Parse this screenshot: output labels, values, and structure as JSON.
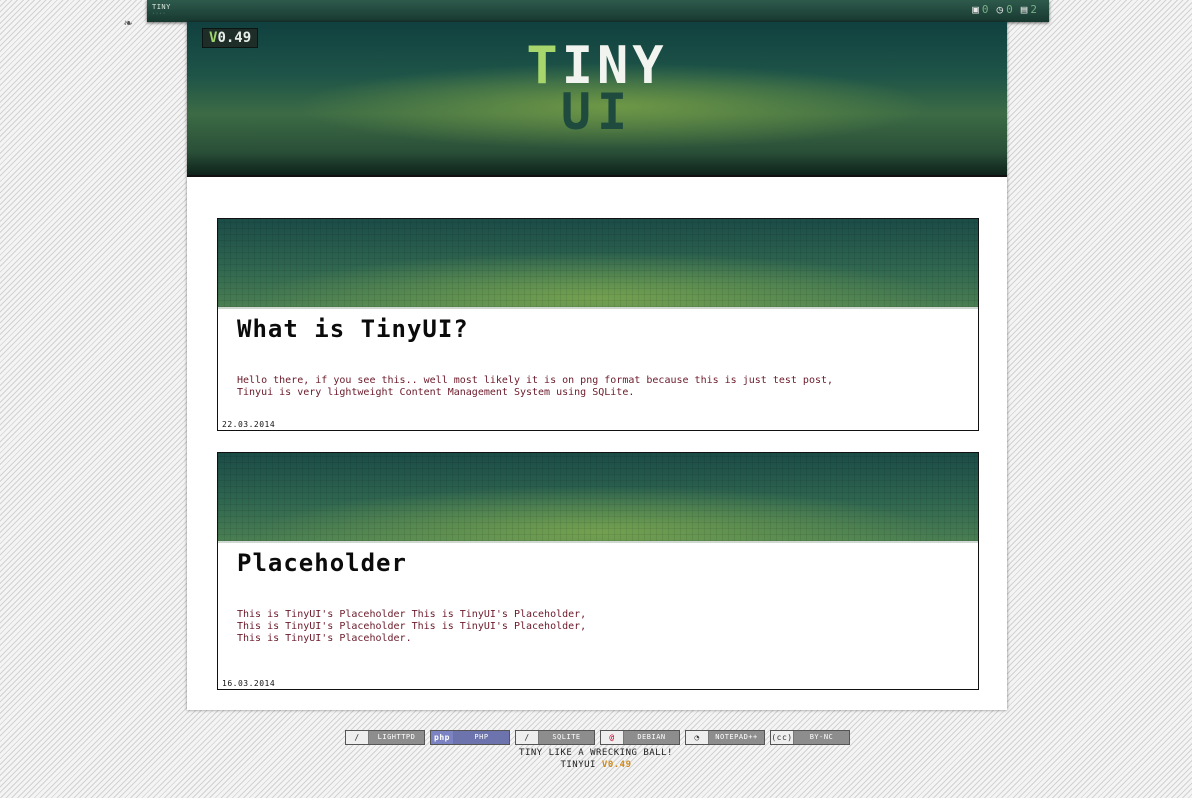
{
  "topbar": {
    "brand": "TINY",
    "stats": [
      {
        "icon": "save-icon",
        "glyph": "▣",
        "value": "0"
      },
      {
        "icon": "clock-icon",
        "glyph": "◷",
        "value": "0"
      },
      {
        "icon": "document-icon",
        "glyph": "▤",
        "value": "2"
      }
    ]
  },
  "header": {
    "version_prefix": "V",
    "version_number": "0.49",
    "logo_first": "T",
    "logo_rest": "INY",
    "logo_sub": "UI"
  },
  "posts": [
    {
      "title": "What is TinyUI?",
      "body": "Hello there, if you see this.. well most likely it is on png format because this is just test post,\nTinyui is very lightweight Content Management System using SQLite.",
      "date": "22.03.2014"
    },
    {
      "title": "Placeholder",
      "body": "This is TinyUI's Placeholder This is TinyUI's Placeholder,\nThis is TinyUI's Placeholder This is TinyUI's Placeholder,\nThis is TinyUI's Placeholder.",
      "date": "16.03.2014"
    }
  ],
  "badges": [
    {
      "icon": "feather-icon",
      "glyph": "∕",
      "label": "LIGHTTPD"
    },
    {
      "icon": "php-logo-icon",
      "glyph": "php",
      "label": "PHP"
    },
    {
      "icon": "feather-icon",
      "glyph": "∕",
      "label": "SQLITE"
    },
    {
      "icon": "debian-swirl-icon",
      "glyph": "@",
      "label": "DEBIAN"
    },
    {
      "icon": "chameleon-icon",
      "glyph": "◔",
      "label": "NOTEPAD++"
    },
    {
      "icon": "creative-commons-icon",
      "glyph": "(cc)",
      "label": "BY-NC"
    }
  ],
  "footer": {
    "tagline": "TINY LIKE A WRECKING BALL!",
    "name": "TINYUI",
    "version_prefix": "V",
    "version_number": "0.49"
  }
}
